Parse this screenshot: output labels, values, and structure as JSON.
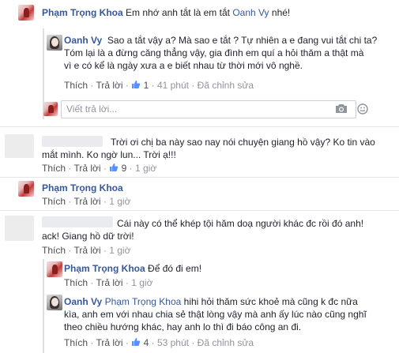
{
  "comments": {
    "c1": {
      "author": "Phạm Trọng Khoa",
      "text_before": "Em nhớ anh tắt là em tắt ",
      "mention": "Oanh Vy",
      "text_after": " nhé!"
    },
    "r1": {
      "author": "Oanh Vy",
      "lines": [
        "Sao a tắt vậy a? Mà sao e tắt ? Tự nhiên a e đang vui tắt chi ta?",
        "Tóm lại là a đừng căng thẳng vậy, gia đình em quí a hỏi thăm a thật mà",
        "vì e có kể là ngày xưa a e biết nhau từ thời mới vô nghề."
      ],
      "like": "Thích",
      "reply": "Trả lời",
      "likes": "1",
      "time": "41 phút",
      "edited": "Đã chỉnh sửa"
    },
    "reply_box": {
      "placeholder": "Viết trả lời..."
    },
    "c2": {
      "lines": [
        "Trời ơi chị ba này sao nay nói chuyện giang hồ vậy? Ko tin vào",
        "mắt mình. Ko ngờ lun... Trời ạ!!!"
      ],
      "like": "Thích",
      "reply": "Trả lời",
      "likes": "9",
      "time": "1 giờ"
    },
    "c3": {
      "author": "Phạm Trọng Khoa",
      "like": "Thích",
      "reply": "Trả lời",
      "time": "1 giờ"
    },
    "c4": {
      "lines": [
        "Cái này có thể khép tội hăm doạ người khác đc rồi đó anh!",
        "ack! Giang hồ dữ trời!"
      ],
      "like": "Thích",
      "reply": "Trả lời",
      "time": "1 giờ"
    },
    "r2": {
      "author": "Phạm Trọng Khoa",
      "text": "Để đó đi em!",
      "like": "Thích",
      "reply": "Trả lời",
      "time": "1 giờ"
    },
    "r3": {
      "author": "Oanh Vy",
      "mention": "Phạm Trọng Khoa",
      "line1": " hihi hỏi thăm sức khoẻ mà cũng k đc nữa",
      "lines": [
        "kìa, anh em với nhau chia sẻ thật lòng vậy mà anh ấy lúc nào cũng nghĩ",
        "theo chiều hướng khác, hay anh lo thì đi báo công an đi."
      ],
      "like": "Thích",
      "reply": "Trả lời",
      "likes": "4",
      "time": "53 phút",
      "edited": "Đã chỉnh sửa"
    }
  },
  "icons": {
    "like": "thumbs-up-icon",
    "camera": "camera-icon",
    "emoji": "emoji-icon"
  },
  "colors": {
    "name": "#365899",
    "meta": "#90949c",
    "like_icon": "#5890ff"
  }
}
